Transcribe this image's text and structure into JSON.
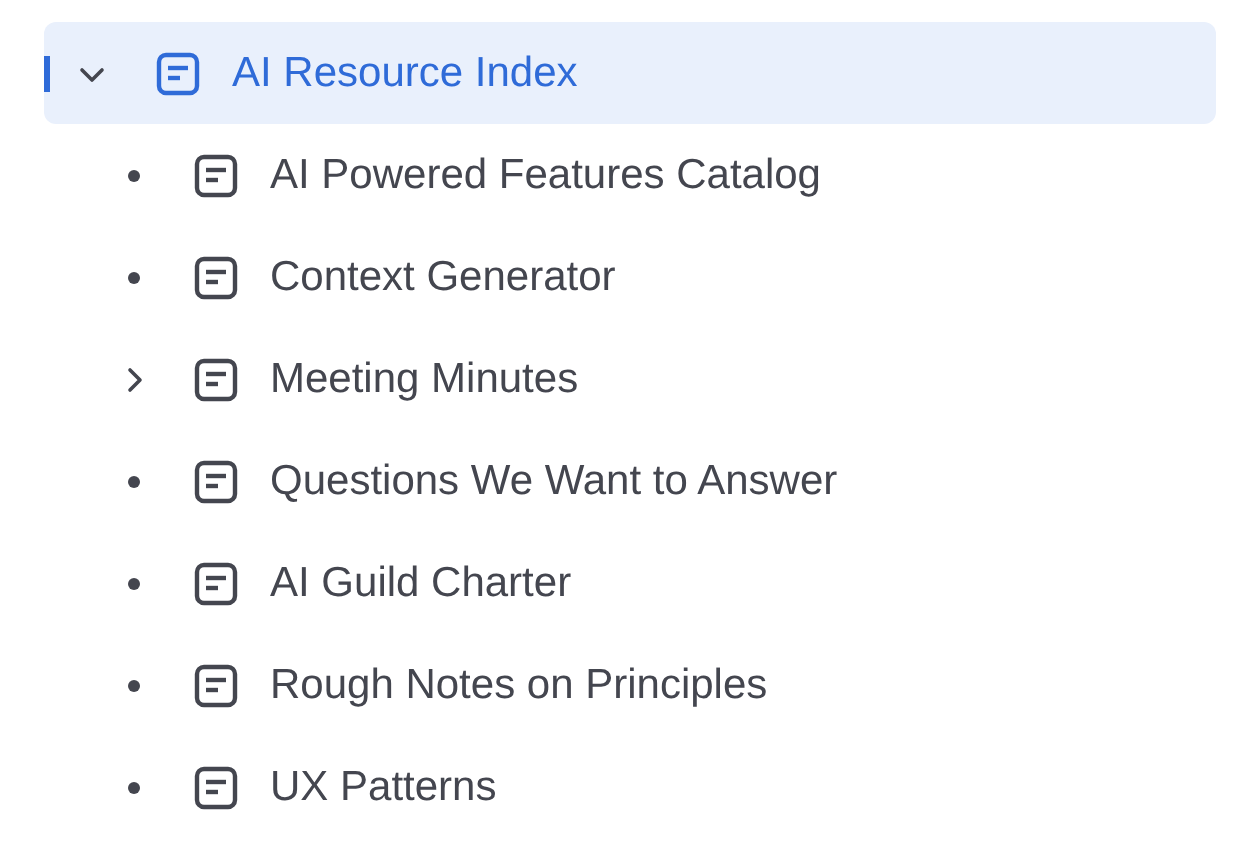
{
  "tree": {
    "label": "AI Resource Index",
    "selected": true,
    "expanded": true,
    "children": [
      {
        "label": "AI Powered Features Catalog",
        "kind": "leaf"
      },
      {
        "label": "Context Generator",
        "kind": "leaf"
      },
      {
        "label": "Meeting Minutes",
        "kind": "parent",
        "expanded": false
      },
      {
        "label": "Questions We Want to Answer",
        "kind": "leaf"
      },
      {
        "label": "AI Guild Charter",
        "kind": "leaf"
      },
      {
        "label": "Rough Notes on Principles",
        "kind": "leaf"
      },
      {
        "label": "UX Patterns",
        "kind": "leaf"
      }
    ]
  }
}
